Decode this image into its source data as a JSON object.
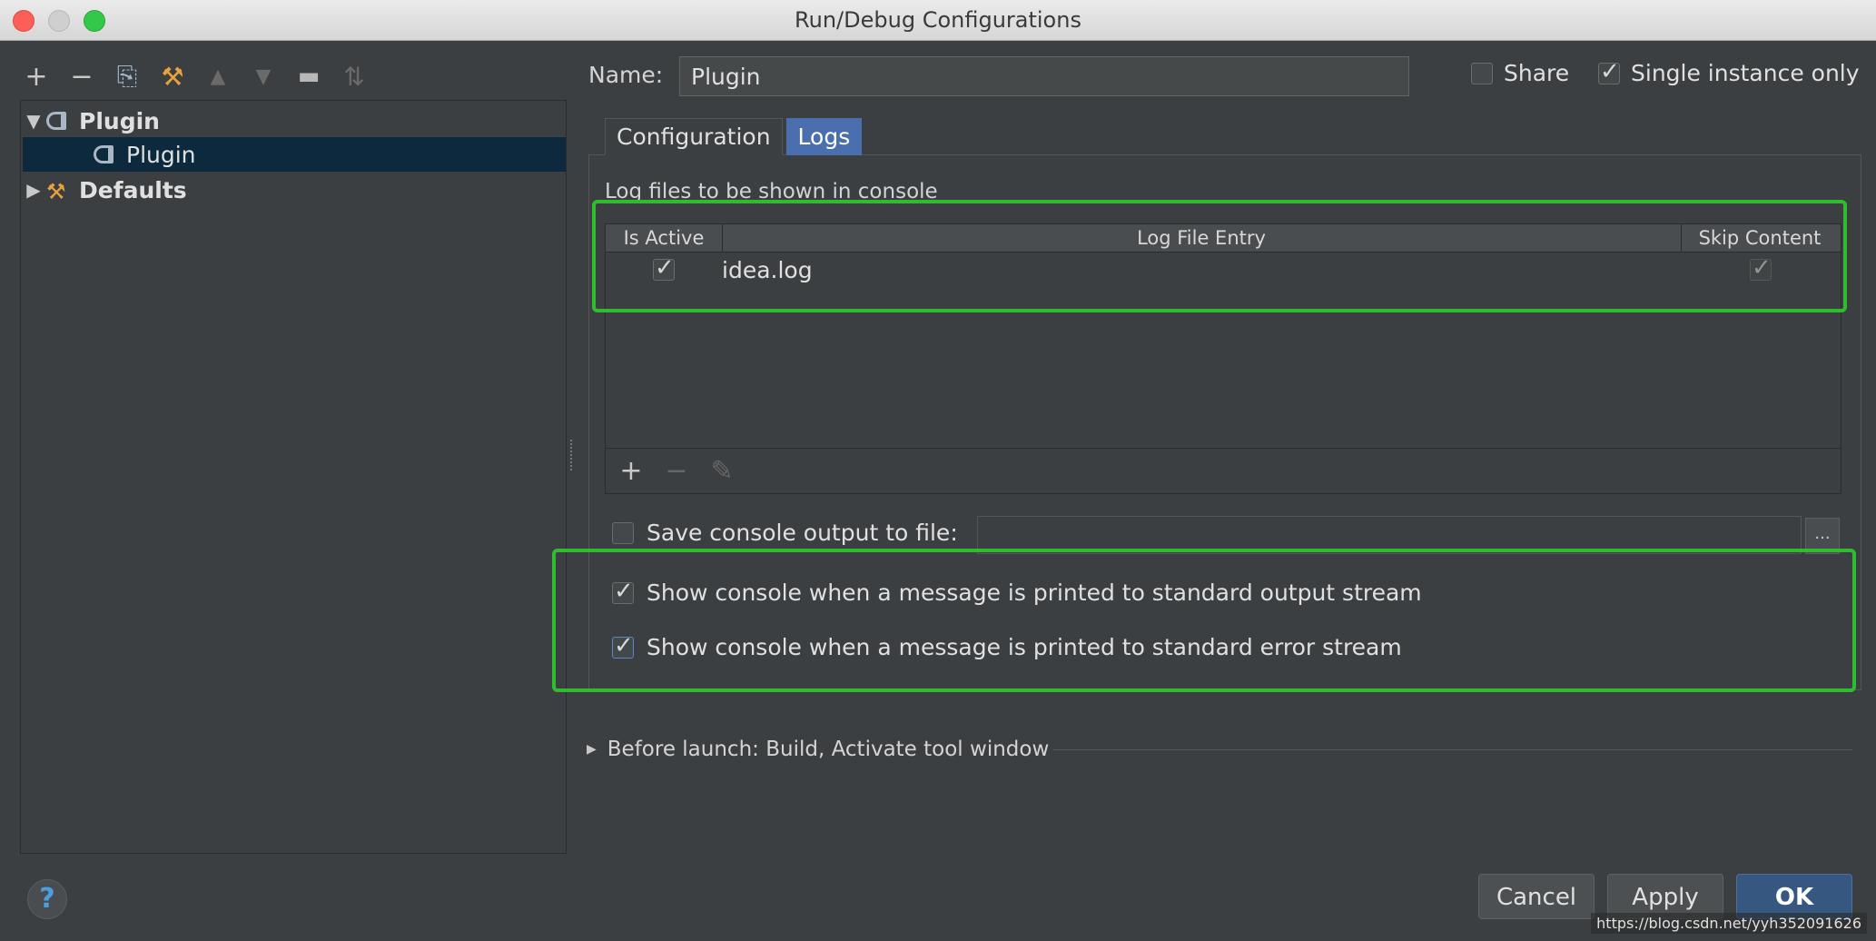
{
  "window": {
    "title": "Run/Debug Configurations"
  },
  "toolbar": {
    "add": "+",
    "remove": "−",
    "copy": "⎘",
    "settings": "⚒",
    "up": "▲",
    "down": "▼",
    "folder": "▬",
    "sort": "⇅"
  },
  "tree": {
    "items": [
      {
        "label": "Plugin",
        "expanded": true
      },
      {
        "label": "Plugin",
        "selected": true
      },
      {
        "label": "Defaults",
        "expanded": false
      }
    ]
  },
  "name_field": {
    "label": "Name:",
    "value": "Plugin"
  },
  "share": {
    "label": "Share",
    "checked": false
  },
  "single_instance": {
    "label": "Single instance only",
    "checked": true
  },
  "tabs": [
    {
      "label": "Configuration",
      "active": false
    },
    {
      "label": "Logs",
      "active": true
    }
  ],
  "logs": {
    "caption": "Log files to be shown in console",
    "columns": [
      "Is Active",
      "Log File Entry",
      "Skip Content"
    ],
    "rows": [
      {
        "active": true,
        "entry": "idea.log",
        "skip": true
      }
    ],
    "tools": {
      "add": "+",
      "remove": "−",
      "edit": "✎"
    }
  },
  "save_console": {
    "label": "Save console output to file:",
    "checked": false,
    "browse": "..."
  },
  "show_stdout": {
    "label": "Show console when a message is printed to standard output stream",
    "checked": true
  },
  "show_stderr": {
    "label": "Show console when a message is printed to standard error stream",
    "checked": true
  },
  "before_launch": {
    "label": "Before launch: Build, Activate tool window"
  },
  "buttons": {
    "cancel": "Cancel",
    "apply": "Apply",
    "ok": "OK",
    "help": "?"
  },
  "watermark": "https://blog.csdn.net/yyh352091626",
  "colors": {
    "highlight": "#2fbd2f",
    "selection": "#0d293e",
    "active_tab": "#4b6eaf",
    "ok_button": "#365880"
  }
}
